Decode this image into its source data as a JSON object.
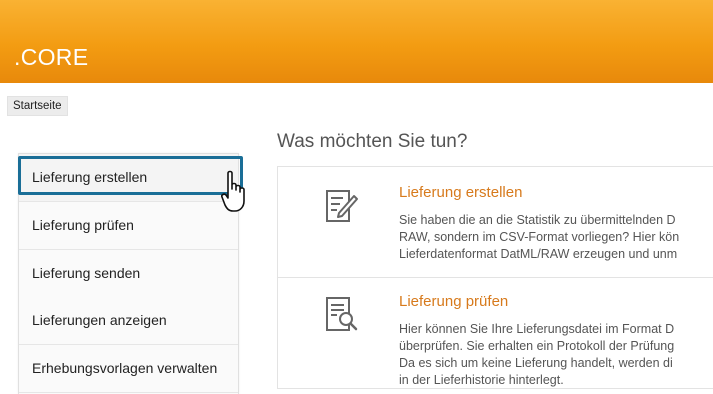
{
  "header": {
    "app_title": ".CORE",
    "accent_color": "#f39c12"
  },
  "breadcrumb": {
    "home": "Startseite"
  },
  "sidebar": {
    "items": [
      {
        "label": "Lieferung erstellen",
        "active": true
      },
      {
        "label": "Lieferung prüfen"
      },
      {
        "label": "Lieferung senden"
      },
      {
        "label": "Lieferungen anzeigen"
      },
      {
        "label": "Erhebungsvorlagen verwalten"
      }
    ]
  },
  "main": {
    "title": "Was möchten Sie tun?",
    "cards": [
      {
        "icon": "edit-document-icon",
        "title": "Lieferung erstellen",
        "lines": [
          "Sie haben die an die Statistik zu übermittelnden D",
          "RAW, sondern im CSV-Format vorliegen? Hier kön",
          "Lieferdatenformat DatML/RAW erzeugen und unm"
        ]
      },
      {
        "icon": "search-document-icon",
        "title": "Lieferung prüfen",
        "lines": [
          "Hier können Sie Ihre Lieferungsdatei im Format D",
          "überprüfen. Sie erhalten ein Protokoll der Prüfung",
          "Da es sich um keine Lieferung handelt, werden di",
          "in der Lieferhistorie hinterlegt."
        ]
      }
    ]
  },
  "annotation": {
    "highlight_color": "#1a6e97",
    "cursor": "hand-pointer-icon"
  }
}
